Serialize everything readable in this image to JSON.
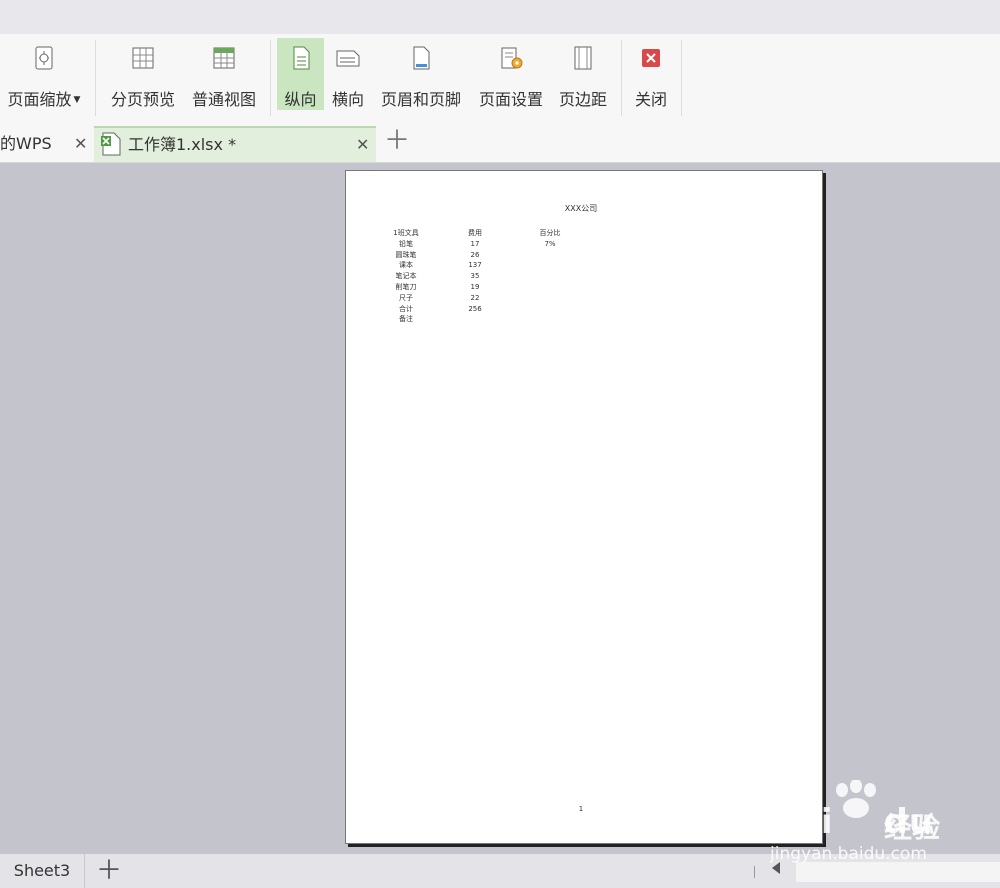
{
  "ribbon": {
    "page_zoom": "页面缩放",
    "page_break_preview": "分页预览",
    "normal_view": "普通视图",
    "portrait": "纵向",
    "landscape": "横向",
    "header_footer": "页眉和页脚",
    "page_setup": "页面设置",
    "margins": "页边距",
    "close": "关闭"
  },
  "tabs": [
    {
      "label": "我的WPS",
      "visible_label": "的WPS",
      "active": false
    },
    {
      "label": "工作簿1.xlsx *",
      "active": true
    }
  ],
  "document": {
    "title": "XXX公司",
    "headers": [
      "1班文具",
      "费用",
      "百分比"
    ],
    "rows": [
      [
        "铅笔",
        "17",
        "7%"
      ],
      [
        "圆珠笔",
        "26",
        ""
      ],
      [
        "课本",
        "137",
        ""
      ],
      [
        "笔记本",
        "35",
        ""
      ],
      [
        "削笔刀",
        "19",
        ""
      ],
      [
        "尺子",
        "22",
        ""
      ],
      [
        "合计",
        "256",
        ""
      ],
      [
        "备注",
        "",
        ""
      ]
    ],
    "page_number": "1"
  },
  "status": {
    "sheet_tab": "Sheet3"
  },
  "watermark": {
    "brand": "Bai",
    "brand2": "du",
    "text": "经验",
    "url": "jingyan.baidu.com"
  },
  "colors": {
    "active_button_bg": "#c9e6c0",
    "active_tab_bg": "#e1efdc",
    "workspace_bg": "#c3c4cc",
    "close_icon": "#d9494b"
  }
}
